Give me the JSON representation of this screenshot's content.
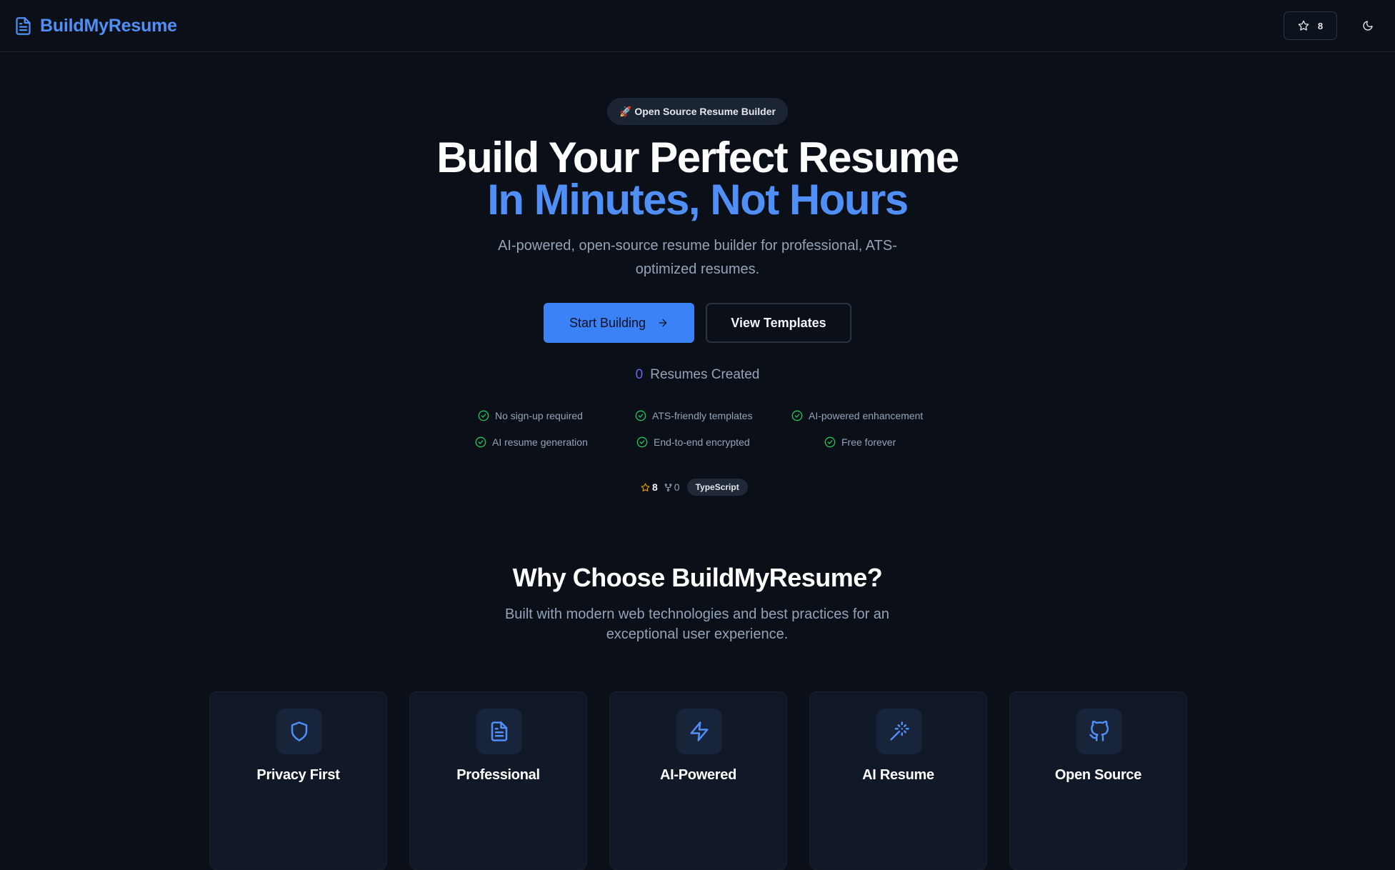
{
  "header": {
    "brand": "BuildMyResume",
    "star_count": "8"
  },
  "hero": {
    "badge": "🚀 Open Source Resume Builder",
    "title_line1": "Build Your Perfect Resume",
    "title_line2": "In Minutes, Not Hours",
    "subtitle": "AI-powered, open-source resume builder for professional, ATS-optimized resumes.",
    "primary_button": "Start Building",
    "secondary_button": "View Templates",
    "counter_value": "0",
    "counter_label": "Resumes Created",
    "features": [
      "No sign-up required",
      "ATS-friendly templates",
      "AI-powered enhancement",
      "AI resume generation",
      "End-to-end encrypted",
      "Free forever"
    ],
    "repo": {
      "stars": "8",
      "forks": "0",
      "language": "TypeScript"
    }
  },
  "why": {
    "title": "Why Choose BuildMyResume?",
    "subtitle": "Built with modern web technologies and best practices for an exceptional user experience.",
    "cards": [
      {
        "title": "Privacy First",
        "icon": "shield-icon"
      },
      {
        "title": "Professional",
        "icon": "document-icon"
      },
      {
        "title": "AI-Powered",
        "icon": "zap-icon"
      },
      {
        "title": "AI Resume",
        "icon": "magic-wand-icon"
      },
      {
        "title": "Open Source",
        "icon": "github-icon"
      }
    ]
  },
  "colors": {
    "background": "#0b1018",
    "accent": "#4f8ff7",
    "primary_button": "#3b82f6",
    "check": "#22c55e",
    "counter": "#6366f1"
  }
}
